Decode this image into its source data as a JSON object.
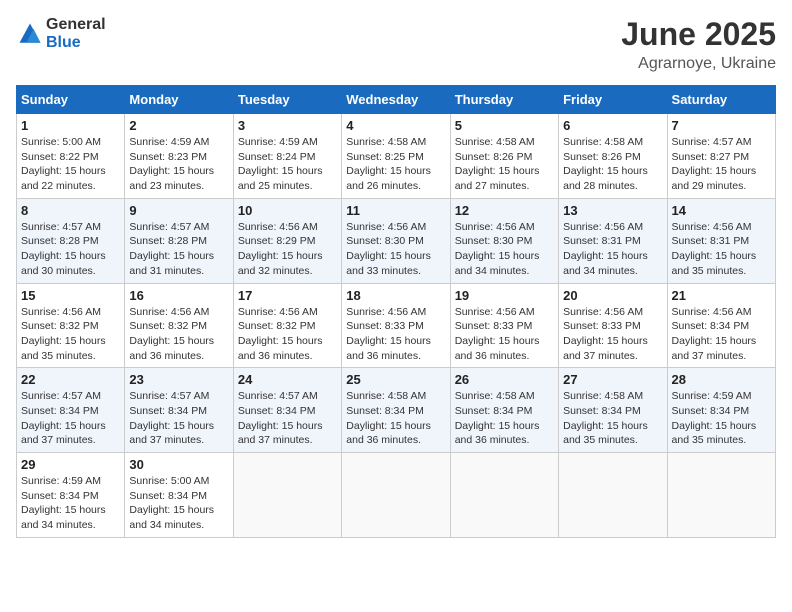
{
  "logo": {
    "general": "General",
    "blue": "Blue"
  },
  "title": "June 2025",
  "subtitle": "Agrarnoye, Ukraine",
  "days_header": [
    "Sunday",
    "Monday",
    "Tuesday",
    "Wednesday",
    "Thursday",
    "Friday",
    "Saturday"
  ],
  "weeks": [
    [
      {
        "day": "1",
        "sunrise": "5:00 AM",
        "sunset": "8:22 PM",
        "daylight": "15 hours and 22 minutes."
      },
      {
        "day": "2",
        "sunrise": "4:59 AM",
        "sunset": "8:23 PM",
        "daylight": "15 hours and 23 minutes."
      },
      {
        "day": "3",
        "sunrise": "4:59 AM",
        "sunset": "8:24 PM",
        "daylight": "15 hours and 25 minutes."
      },
      {
        "day": "4",
        "sunrise": "4:58 AM",
        "sunset": "8:25 PM",
        "daylight": "15 hours and 26 minutes."
      },
      {
        "day": "5",
        "sunrise": "4:58 AM",
        "sunset": "8:26 PM",
        "daylight": "15 hours and 27 minutes."
      },
      {
        "day": "6",
        "sunrise": "4:58 AM",
        "sunset": "8:26 PM",
        "daylight": "15 hours and 28 minutes."
      },
      {
        "day": "7",
        "sunrise": "4:57 AM",
        "sunset": "8:27 PM",
        "daylight": "15 hours and 29 minutes."
      }
    ],
    [
      {
        "day": "8",
        "sunrise": "4:57 AM",
        "sunset": "8:28 PM",
        "daylight": "15 hours and 30 minutes."
      },
      {
        "day": "9",
        "sunrise": "4:57 AM",
        "sunset": "8:28 PM",
        "daylight": "15 hours and 31 minutes."
      },
      {
        "day": "10",
        "sunrise": "4:56 AM",
        "sunset": "8:29 PM",
        "daylight": "15 hours and 32 minutes."
      },
      {
        "day": "11",
        "sunrise": "4:56 AM",
        "sunset": "8:30 PM",
        "daylight": "15 hours and 33 minutes."
      },
      {
        "day": "12",
        "sunrise": "4:56 AM",
        "sunset": "8:30 PM",
        "daylight": "15 hours and 34 minutes."
      },
      {
        "day": "13",
        "sunrise": "4:56 AM",
        "sunset": "8:31 PM",
        "daylight": "15 hours and 34 minutes."
      },
      {
        "day": "14",
        "sunrise": "4:56 AM",
        "sunset": "8:31 PM",
        "daylight": "15 hours and 35 minutes."
      }
    ],
    [
      {
        "day": "15",
        "sunrise": "4:56 AM",
        "sunset": "8:32 PM",
        "daylight": "15 hours and 35 minutes."
      },
      {
        "day": "16",
        "sunrise": "4:56 AM",
        "sunset": "8:32 PM",
        "daylight": "15 hours and 36 minutes."
      },
      {
        "day": "17",
        "sunrise": "4:56 AM",
        "sunset": "8:32 PM",
        "daylight": "15 hours and 36 minutes."
      },
      {
        "day": "18",
        "sunrise": "4:56 AM",
        "sunset": "8:33 PM",
        "daylight": "15 hours and 36 minutes."
      },
      {
        "day": "19",
        "sunrise": "4:56 AM",
        "sunset": "8:33 PM",
        "daylight": "15 hours and 36 minutes."
      },
      {
        "day": "20",
        "sunrise": "4:56 AM",
        "sunset": "8:33 PM",
        "daylight": "15 hours and 37 minutes."
      },
      {
        "day": "21",
        "sunrise": "4:56 AM",
        "sunset": "8:34 PM",
        "daylight": "15 hours and 37 minutes."
      }
    ],
    [
      {
        "day": "22",
        "sunrise": "4:57 AM",
        "sunset": "8:34 PM",
        "daylight": "15 hours and 37 minutes."
      },
      {
        "day": "23",
        "sunrise": "4:57 AM",
        "sunset": "8:34 PM",
        "daylight": "15 hours and 37 minutes."
      },
      {
        "day": "24",
        "sunrise": "4:57 AM",
        "sunset": "8:34 PM",
        "daylight": "15 hours and 37 minutes."
      },
      {
        "day": "25",
        "sunrise": "4:58 AM",
        "sunset": "8:34 PM",
        "daylight": "15 hours and 36 minutes."
      },
      {
        "day": "26",
        "sunrise": "4:58 AM",
        "sunset": "8:34 PM",
        "daylight": "15 hours and 36 minutes."
      },
      {
        "day": "27",
        "sunrise": "4:58 AM",
        "sunset": "8:34 PM",
        "daylight": "15 hours and 35 minutes."
      },
      {
        "day": "28",
        "sunrise": "4:59 AM",
        "sunset": "8:34 PM",
        "daylight": "15 hours and 35 minutes."
      }
    ],
    [
      {
        "day": "29",
        "sunrise": "4:59 AM",
        "sunset": "8:34 PM",
        "daylight": "15 hours and 34 minutes."
      },
      {
        "day": "30",
        "sunrise": "5:00 AM",
        "sunset": "8:34 PM",
        "daylight": "15 hours and 34 minutes."
      },
      null,
      null,
      null,
      null,
      null
    ]
  ],
  "labels": {
    "sunrise": "Sunrise:",
    "sunset": "Sunset:",
    "daylight": "Daylight:"
  }
}
